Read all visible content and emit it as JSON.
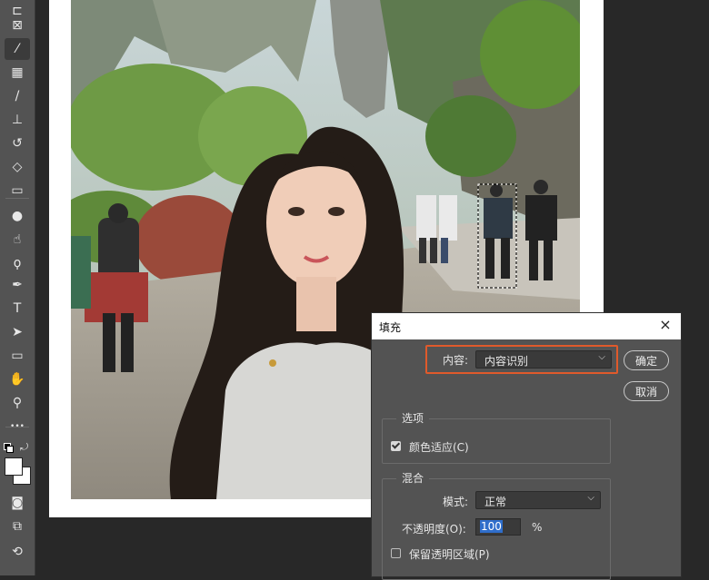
{
  "toolbar": {
    "tools": [
      {
        "name": "artboard-tool-icon",
        "glyph": "⊏"
      },
      {
        "name": "frame-tool-icon",
        "glyph": "⊠"
      },
      {
        "name": "eyedropper-tool-icon",
        "glyph": "⁄",
        "active": true
      },
      {
        "name": "spot-healing-tool-icon",
        "glyph": "▦"
      },
      {
        "name": "brush-tool-icon",
        "glyph": "/"
      },
      {
        "name": "clone-stamp-tool-icon",
        "glyph": "⊥"
      },
      {
        "name": "history-brush-tool-icon",
        "glyph": "↺"
      },
      {
        "name": "eraser-tool-icon",
        "glyph": "◇"
      },
      {
        "name": "gradient-tool-icon",
        "glyph": "▭"
      },
      {
        "name": "blur-tool-icon",
        "glyph": "●"
      },
      {
        "name": "smudge-tool-icon",
        "glyph": "☝"
      },
      {
        "name": "dodge-tool-icon",
        "glyph": "ϙ"
      },
      {
        "name": "pen-tool-icon",
        "glyph": "✒"
      },
      {
        "name": "type-tool-icon",
        "glyph": "T"
      },
      {
        "name": "path-selection-tool-icon",
        "glyph": "➤"
      },
      {
        "name": "rectangle-tool-icon",
        "glyph": "▭"
      },
      {
        "name": "hand-tool-icon",
        "glyph": "✋"
      },
      {
        "name": "zoom-tool-icon",
        "glyph": "⚲"
      },
      {
        "name": "more-tools-icon",
        "glyph": "•••"
      }
    ],
    "bottom_tools": [
      {
        "name": "quick-mask-icon",
        "glyph": "◙"
      },
      {
        "name": "screen-mode-icon",
        "glyph": "⧉"
      },
      {
        "name": "share-icon",
        "glyph": "⟲"
      }
    ],
    "foreground_color": "#ffffff",
    "background_color": "#ffffff"
  },
  "dialog": {
    "title": "填充",
    "close_icon": "×",
    "contents_label": "内容:",
    "contents_value": "内容识别",
    "ok_button": "确定",
    "cancel_button": "取消",
    "options_group_title": "选项",
    "color_adaptation_label": "颜色适应(C)",
    "color_adaptation_checked": true,
    "blending_group_title": "混合",
    "mode_label": "模式:",
    "mode_value": "正常",
    "opacity_label": "不透明度(O):",
    "opacity_value": "100",
    "opacity_unit": "%",
    "preserve_transparency_label": "保留透明区域(P)",
    "preserve_transparency_checked": false,
    "highlight_color": "#e05a2b"
  },
  "canvas": {
    "background": "#ffffff",
    "workspace_color": "#282828"
  }
}
